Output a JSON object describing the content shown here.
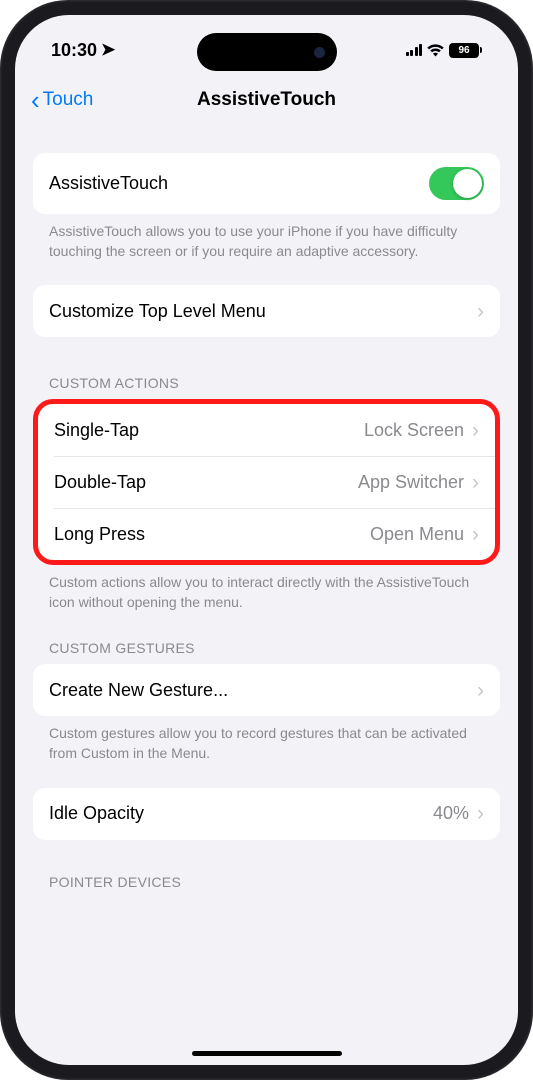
{
  "statusbar": {
    "time": "10:30",
    "battery_pct": "96"
  },
  "nav": {
    "back_label": "Touch",
    "title": "AssistiveTouch"
  },
  "sections": {
    "main_toggle": {
      "label": "AssistiveTouch",
      "enabled": true,
      "footer": "AssistiveTouch allows you to use your iPhone if you have difficulty touching the screen or if you require an adaptive accessory."
    },
    "customize": {
      "label": "Customize Top Level Menu"
    },
    "custom_actions": {
      "header": "CUSTOM ACTIONS",
      "rows": [
        {
          "label": "Single-Tap",
          "value": "Lock Screen"
        },
        {
          "label": "Double-Tap",
          "value": "App Switcher"
        },
        {
          "label": "Long Press",
          "value": "Open Menu"
        }
      ],
      "footer": "Custom actions allow you to interact directly with the AssistiveTouch icon without opening the menu."
    },
    "custom_gestures": {
      "header": "CUSTOM GESTURES",
      "label": "Create New Gesture...",
      "footer": "Custom gestures allow you to record gestures that can be activated from Custom in the Menu."
    },
    "idle_opacity": {
      "label": "Idle Opacity",
      "value": "40%"
    },
    "pointer_devices": {
      "header": "POINTER DEVICES"
    }
  }
}
